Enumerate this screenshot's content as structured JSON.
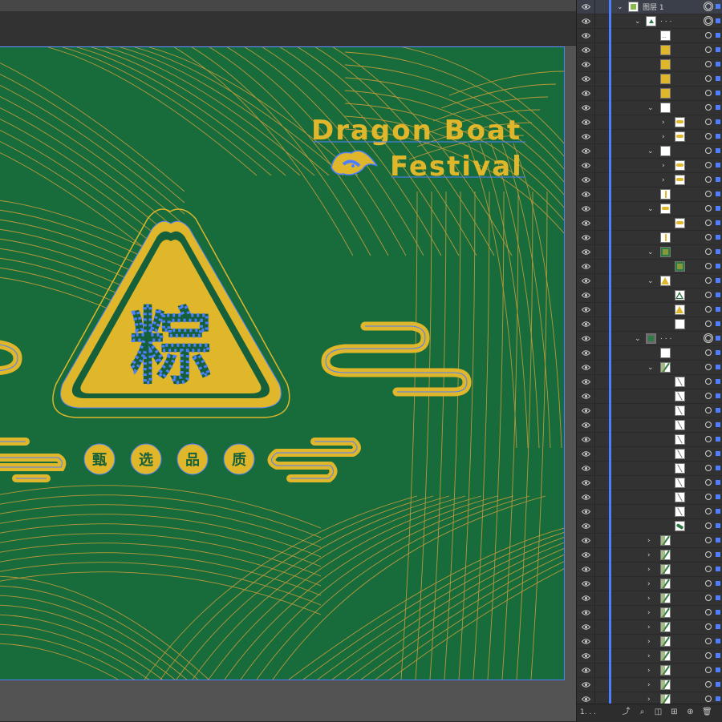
{
  "artwork": {
    "title_line1": "Dragon Boat",
    "title_line2": "Festival",
    "main_char": "粽",
    "tags": [
      "甄",
      "选",
      "品",
      "质"
    ],
    "colors": {
      "bg": "#186c3c",
      "gold": "#e0b62b",
      "line": "#b8983a",
      "dark": "#15603a",
      "anchor": "#4f7fff"
    }
  },
  "layers_panel": {
    "top_layer_name": "图层 1",
    "ellipsis": ". . .",
    "count_label": "1. . .",
    "footer_icons": [
      "export-icon",
      "search-icon",
      "clipping-mask-icon",
      "new-sublayer-icon",
      "new-layer-icon",
      "delete-icon"
    ]
  }
}
